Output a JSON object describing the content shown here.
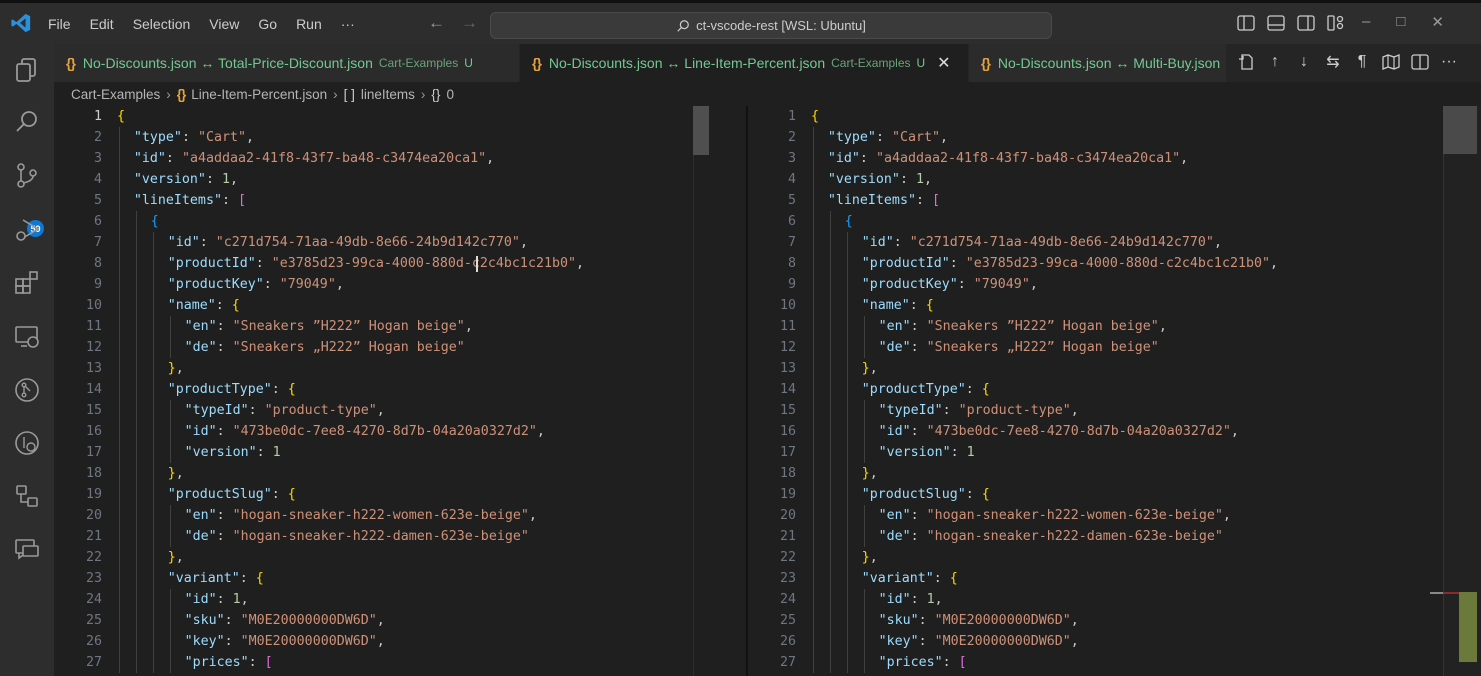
{
  "titlebar": {
    "menu": [
      "File",
      "Edit",
      "Selection",
      "View",
      "Go",
      "Run",
      "···"
    ],
    "command_center": "ct-vscode-rest [WSL: Ubuntu]",
    "icons": [
      "toggle-primary-sidebar-icon",
      "toggle-panel-icon",
      "toggle-secondary-sidebar-icon",
      "customize-layout-icon"
    ],
    "window_controls": [
      "minimize",
      "maximize",
      "close"
    ]
  },
  "activitybar": {
    "items": [
      "explorer",
      "search",
      "source-control",
      "run-and-debug",
      "extensions",
      "remote-explorer",
      "github",
      "gitlens",
      "workspaces",
      "chat"
    ],
    "source_control_badge": "59"
  },
  "tabs": [
    {
      "label": "No-Discounts.json ↔ Total-Price-Discount.json",
      "desc": "Cart-Examples",
      "status": "U",
      "active": false
    },
    {
      "label": "No-Discounts.json ↔ Line-Item-Percent.json",
      "desc": "Cart-Examples",
      "status": "U",
      "active": true,
      "close": "✕"
    },
    {
      "label": "No-Discounts.json ↔ Multi-Buy.json",
      "desc": "",
      "status": "",
      "active": false
    }
  ],
  "editor_actions": [
    "open-file",
    "previous-change",
    "next-change",
    "swap-sides",
    "show-whitespace",
    "toggle-minimap",
    "split-editor",
    "more-actions"
  ],
  "breadcrumb": [
    "Cart-Examples",
    "Line-Item-Percent.json",
    "lineItems",
    "0"
  ],
  "colors": {
    "key": "#9cdcfe",
    "string": "#ce9178",
    "number": "#b5cea8",
    "modified_tab": "#73c991",
    "json_icon": "#e5a33b",
    "badge": "#0e78d4"
  },
  "code_lines": [
    {
      "n": "1",
      "indent": 0,
      "tokens": [
        [
          "b1",
          "{"
        ]
      ]
    },
    {
      "n": "2",
      "indent": 1,
      "tokens": [
        [
          "k",
          "\"type\""
        ],
        [
          "p",
          ": "
        ],
        [
          "s",
          "\"Cart\""
        ],
        [
          "p",
          ","
        ]
      ]
    },
    {
      "n": "3",
      "indent": 1,
      "tokens": [
        [
          "k",
          "\"id\""
        ],
        [
          "p",
          ": "
        ],
        [
          "s",
          "\"a4addaa2-41f8-43f7-ba48-c3474ea20ca1\""
        ],
        [
          "p",
          ","
        ]
      ]
    },
    {
      "n": "4",
      "indent": 1,
      "tokens": [
        [
          "k",
          "\"version\""
        ],
        [
          "p",
          ": "
        ],
        [
          "n",
          "1"
        ],
        [
          "p",
          ","
        ]
      ]
    },
    {
      "n": "5",
      "indent": 1,
      "tokens": [
        [
          "k",
          "\"lineItems\""
        ],
        [
          "p",
          ": "
        ],
        [
          "b2",
          "["
        ]
      ]
    },
    {
      "n": "6",
      "indent": 2,
      "tokens": [
        [
          "b3",
          "{"
        ]
      ]
    },
    {
      "n": "7",
      "indent": 3,
      "tokens": [
        [
          "k",
          "\"id\""
        ],
        [
          "p",
          ": "
        ],
        [
          "s",
          "\"c271d754-71aa-49db-8e66-24b9d142c770\""
        ],
        [
          "p",
          ","
        ]
      ]
    },
    {
      "n": "8",
      "indent": 3,
      "tokens": [
        [
          "k",
          "\"productId\""
        ],
        [
          "p",
          ": "
        ],
        [
          "s",
          "\"e3785d23-99ca-4000-880d-c2c4bc1c21b0\""
        ],
        [
          "p",
          ","
        ]
      ]
    },
    {
      "n": "9",
      "indent": 3,
      "tokens": [
        [
          "k",
          "\"productKey\""
        ],
        [
          "p",
          ": "
        ],
        [
          "s",
          "\"79049\""
        ],
        [
          "p",
          ","
        ]
      ]
    },
    {
      "n": "10",
      "indent": 3,
      "tokens": [
        [
          "k",
          "\"name\""
        ],
        [
          "p",
          ": "
        ],
        [
          "b1",
          "{"
        ]
      ]
    },
    {
      "n": "11",
      "indent": 4,
      "tokens": [
        [
          "k",
          "\"en\""
        ],
        [
          "p",
          ": "
        ],
        [
          "s",
          "\"Sneakers ”H222” Hogan beige\""
        ],
        [
          "p",
          ","
        ]
      ]
    },
    {
      "n": "12",
      "indent": 4,
      "tokens": [
        [
          "k",
          "\"de\""
        ],
        [
          "p",
          ": "
        ],
        [
          "s",
          "\"Sneakers „H222” Hogan beige\""
        ]
      ]
    },
    {
      "n": "13",
      "indent": 3,
      "tokens": [
        [
          "b1",
          "}"
        ],
        [
          "p",
          ","
        ]
      ]
    },
    {
      "n": "14",
      "indent": 3,
      "tokens": [
        [
          "k",
          "\"productType\""
        ],
        [
          "p",
          ": "
        ],
        [
          "b1",
          "{"
        ]
      ]
    },
    {
      "n": "15",
      "indent": 4,
      "tokens": [
        [
          "k",
          "\"typeId\""
        ],
        [
          "p",
          ": "
        ],
        [
          "s",
          "\"product-type\""
        ],
        [
          "p",
          ","
        ]
      ]
    },
    {
      "n": "16",
      "indent": 4,
      "tokens": [
        [
          "k",
          "\"id\""
        ],
        [
          "p",
          ": "
        ],
        [
          "s",
          "\"473be0dc-7ee8-4270-8d7b-04a20a0327d2\""
        ],
        [
          "p",
          ","
        ]
      ]
    },
    {
      "n": "17",
      "indent": 4,
      "tokens": [
        [
          "k",
          "\"version\""
        ],
        [
          "p",
          ": "
        ],
        [
          "n",
          "1"
        ]
      ]
    },
    {
      "n": "18",
      "indent": 3,
      "tokens": [
        [
          "b1",
          "}"
        ],
        [
          "p",
          ","
        ]
      ]
    },
    {
      "n": "19",
      "indent": 3,
      "tokens": [
        [
          "k",
          "\"productSlug\""
        ],
        [
          "p",
          ": "
        ],
        [
          "b1",
          "{"
        ]
      ]
    },
    {
      "n": "20",
      "indent": 4,
      "tokens": [
        [
          "k",
          "\"en\""
        ],
        [
          "p",
          ": "
        ],
        [
          "s",
          "\"hogan-sneaker-h222-women-623e-beige\""
        ],
        [
          "p",
          ","
        ]
      ]
    },
    {
      "n": "21",
      "indent": 4,
      "tokens": [
        [
          "k",
          "\"de\""
        ],
        [
          "p",
          ": "
        ],
        [
          "s",
          "\"hogan-sneaker-h222-damen-623e-beige\""
        ]
      ]
    },
    {
      "n": "22",
      "indent": 3,
      "tokens": [
        [
          "b1",
          "}"
        ],
        [
          "p",
          ","
        ]
      ]
    },
    {
      "n": "23",
      "indent": 3,
      "tokens": [
        [
          "k",
          "\"variant\""
        ],
        [
          "p",
          ": "
        ],
        [
          "b1",
          "{"
        ]
      ]
    },
    {
      "n": "24",
      "indent": 4,
      "tokens": [
        [
          "k",
          "\"id\""
        ],
        [
          "p",
          ": "
        ],
        [
          "n",
          "1"
        ],
        [
          "p",
          ","
        ]
      ]
    },
    {
      "n": "25",
      "indent": 4,
      "tokens": [
        [
          "k",
          "\"sku\""
        ],
        [
          "p",
          ": "
        ],
        [
          "s",
          "\"M0E20000000DW6D\""
        ],
        [
          "p",
          ","
        ]
      ]
    },
    {
      "n": "26",
      "indent": 4,
      "tokens": [
        [
          "k",
          "\"key\""
        ],
        [
          "p",
          ": "
        ],
        [
          "s",
          "\"M0E20000000DW6D\""
        ],
        [
          "p",
          ","
        ]
      ]
    },
    {
      "n": "27",
      "indent": 4,
      "tokens": [
        [
          "k",
          "\"prices\""
        ],
        [
          "p",
          ": "
        ],
        [
          "b2",
          "["
        ]
      ]
    }
  ]
}
